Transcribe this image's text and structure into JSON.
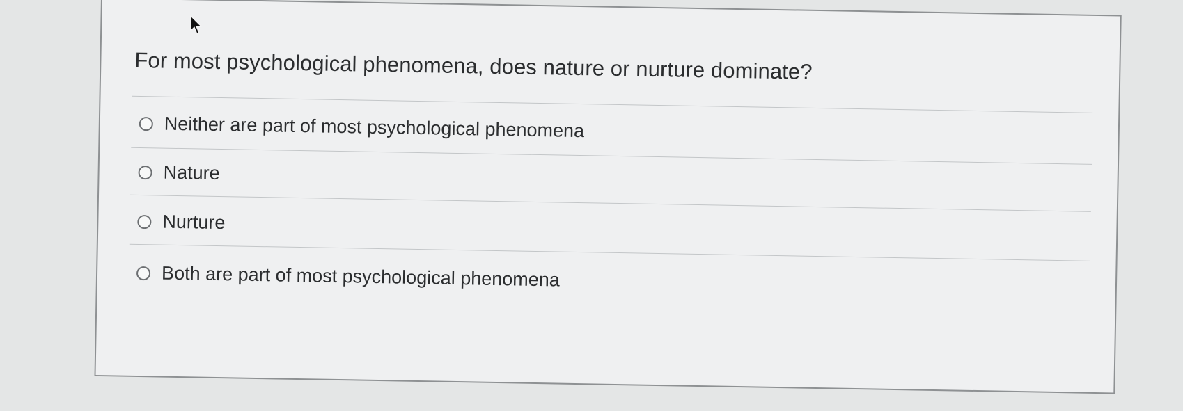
{
  "question": {
    "prompt": "For most psychological phenomena, does nature or nurture dominate?",
    "selected": null,
    "options": [
      {
        "label": "Neither are part of most psychological phenomena"
      },
      {
        "label": "Nature"
      },
      {
        "label": "Nurture"
      },
      {
        "label": "Both are part of most psychological phenomena"
      }
    ]
  },
  "icons": {
    "cursor": "mouse-pointer-icon",
    "radio": "radio-unselected-icon"
  },
  "colors": {
    "background": "#e4e6e6",
    "card": "#eff0f1",
    "text": "#2b2d2f",
    "divider": "#c3c6c8"
  }
}
